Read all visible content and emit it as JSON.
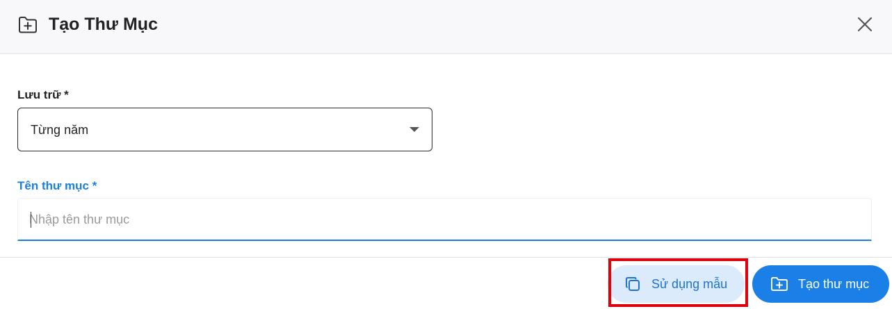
{
  "header": {
    "title": "Tạo Thư Mục",
    "icon": "folder-plus-icon",
    "close_icon": "close-icon"
  },
  "form": {
    "storage": {
      "label": "Lưu trữ *",
      "value": "Từng năm"
    },
    "folder_name": {
      "label": "Tên thư mục *",
      "value": "",
      "placeholder": "Nhập tên thư mục"
    }
  },
  "footer": {
    "use_template": {
      "label": "Sử dụng mẫu",
      "icon": "copy-icon"
    },
    "create_folder": {
      "label": "Tạo thư mục",
      "icon": "folder-plus-icon"
    }
  },
  "colors": {
    "accent": "#1a7fe6",
    "template_button_bg": "#dcebfb",
    "highlight": "#e0000b"
  }
}
